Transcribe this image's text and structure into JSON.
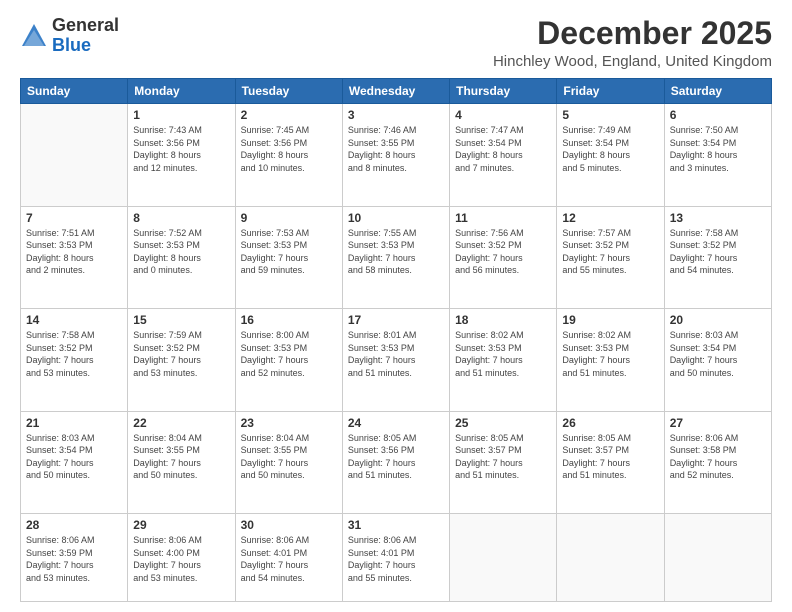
{
  "logo": {
    "general": "General",
    "blue": "Blue"
  },
  "header": {
    "month_title": "December 2025",
    "location": "Hinchley Wood, England, United Kingdom"
  },
  "days_of_week": [
    "Sunday",
    "Monday",
    "Tuesday",
    "Wednesday",
    "Thursday",
    "Friday",
    "Saturday"
  ],
  "weeks": [
    [
      {
        "day": "",
        "info": ""
      },
      {
        "day": "1",
        "info": "Sunrise: 7:43 AM\nSunset: 3:56 PM\nDaylight: 8 hours\nand 12 minutes."
      },
      {
        "day": "2",
        "info": "Sunrise: 7:45 AM\nSunset: 3:56 PM\nDaylight: 8 hours\nand 10 minutes."
      },
      {
        "day": "3",
        "info": "Sunrise: 7:46 AM\nSunset: 3:55 PM\nDaylight: 8 hours\nand 8 minutes."
      },
      {
        "day": "4",
        "info": "Sunrise: 7:47 AM\nSunset: 3:54 PM\nDaylight: 8 hours\nand 7 minutes."
      },
      {
        "day": "5",
        "info": "Sunrise: 7:49 AM\nSunset: 3:54 PM\nDaylight: 8 hours\nand 5 minutes."
      },
      {
        "day": "6",
        "info": "Sunrise: 7:50 AM\nSunset: 3:54 PM\nDaylight: 8 hours\nand 3 minutes."
      }
    ],
    [
      {
        "day": "7",
        "info": "Sunrise: 7:51 AM\nSunset: 3:53 PM\nDaylight: 8 hours\nand 2 minutes."
      },
      {
        "day": "8",
        "info": "Sunrise: 7:52 AM\nSunset: 3:53 PM\nDaylight: 8 hours\nand 0 minutes."
      },
      {
        "day": "9",
        "info": "Sunrise: 7:53 AM\nSunset: 3:53 PM\nDaylight: 7 hours\nand 59 minutes."
      },
      {
        "day": "10",
        "info": "Sunrise: 7:55 AM\nSunset: 3:53 PM\nDaylight: 7 hours\nand 58 minutes."
      },
      {
        "day": "11",
        "info": "Sunrise: 7:56 AM\nSunset: 3:52 PM\nDaylight: 7 hours\nand 56 minutes."
      },
      {
        "day": "12",
        "info": "Sunrise: 7:57 AM\nSunset: 3:52 PM\nDaylight: 7 hours\nand 55 minutes."
      },
      {
        "day": "13",
        "info": "Sunrise: 7:58 AM\nSunset: 3:52 PM\nDaylight: 7 hours\nand 54 minutes."
      }
    ],
    [
      {
        "day": "14",
        "info": "Sunrise: 7:58 AM\nSunset: 3:52 PM\nDaylight: 7 hours\nand 53 minutes."
      },
      {
        "day": "15",
        "info": "Sunrise: 7:59 AM\nSunset: 3:52 PM\nDaylight: 7 hours\nand 53 minutes."
      },
      {
        "day": "16",
        "info": "Sunrise: 8:00 AM\nSunset: 3:53 PM\nDaylight: 7 hours\nand 52 minutes."
      },
      {
        "day": "17",
        "info": "Sunrise: 8:01 AM\nSunset: 3:53 PM\nDaylight: 7 hours\nand 51 minutes."
      },
      {
        "day": "18",
        "info": "Sunrise: 8:02 AM\nSunset: 3:53 PM\nDaylight: 7 hours\nand 51 minutes."
      },
      {
        "day": "19",
        "info": "Sunrise: 8:02 AM\nSunset: 3:53 PM\nDaylight: 7 hours\nand 51 minutes."
      },
      {
        "day": "20",
        "info": "Sunrise: 8:03 AM\nSunset: 3:54 PM\nDaylight: 7 hours\nand 50 minutes."
      }
    ],
    [
      {
        "day": "21",
        "info": "Sunrise: 8:03 AM\nSunset: 3:54 PM\nDaylight: 7 hours\nand 50 minutes."
      },
      {
        "day": "22",
        "info": "Sunrise: 8:04 AM\nSunset: 3:55 PM\nDaylight: 7 hours\nand 50 minutes."
      },
      {
        "day": "23",
        "info": "Sunrise: 8:04 AM\nSunset: 3:55 PM\nDaylight: 7 hours\nand 50 minutes."
      },
      {
        "day": "24",
        "info": "Sunrise: 8:05 AM\nSunset: 3:56 PM\nDaylight: 7 hours\nand 51 minutes."
      },
      {
        "day": "25",
        "info": "Sunrise: 8:05 AM\nSunset: 3:57 PM\nDaylight: 7 hours\nand 51 minutes."
      },
      {
        "day": "26",
        "info": "Sunrise: 8:05 AM\nSunset: 3:57 PM\nDaylight: 7 hours\nand 51 minutes."
      },
      {
        "day": "27",
        "info": "Sunrise: 8:06 AM\nSunset: 3:58 PM\nDaylight: 7 hours\nand 52 minutes."
      }
    ],
    [
      {
        "day": "28",
        "info": "Sunrise: 8:06 AM\nSunset: 3:59 PM\nDaylight: 7 hours\nand 53 minutes."
      },
      {
        "day": "29",
        "info": "Sunrise: 8:06 AM\nSunset: 4:00 PM\nDaylight: 7 hours\nand 53 minutes."
      },
      {
        "day": "30",
        "info": "Sunrise: 8:06 AM\nSunset: 4:01 PM\nDaylight: 7 hours\nand 54 minutes."
      },
      {
        "day": "31",
        "info": "Sunrise: 8:06 AM\nSunset: 4:01 PM\nDaylight: 7 hours\nand 55 minutes."
      },
      {
        "day": "",
        "info": ""
      },
      {
        "day": "",
        "info": ""
      },
      {
        "day": "",
        "info": ""
      }
    ]
  ]
}
